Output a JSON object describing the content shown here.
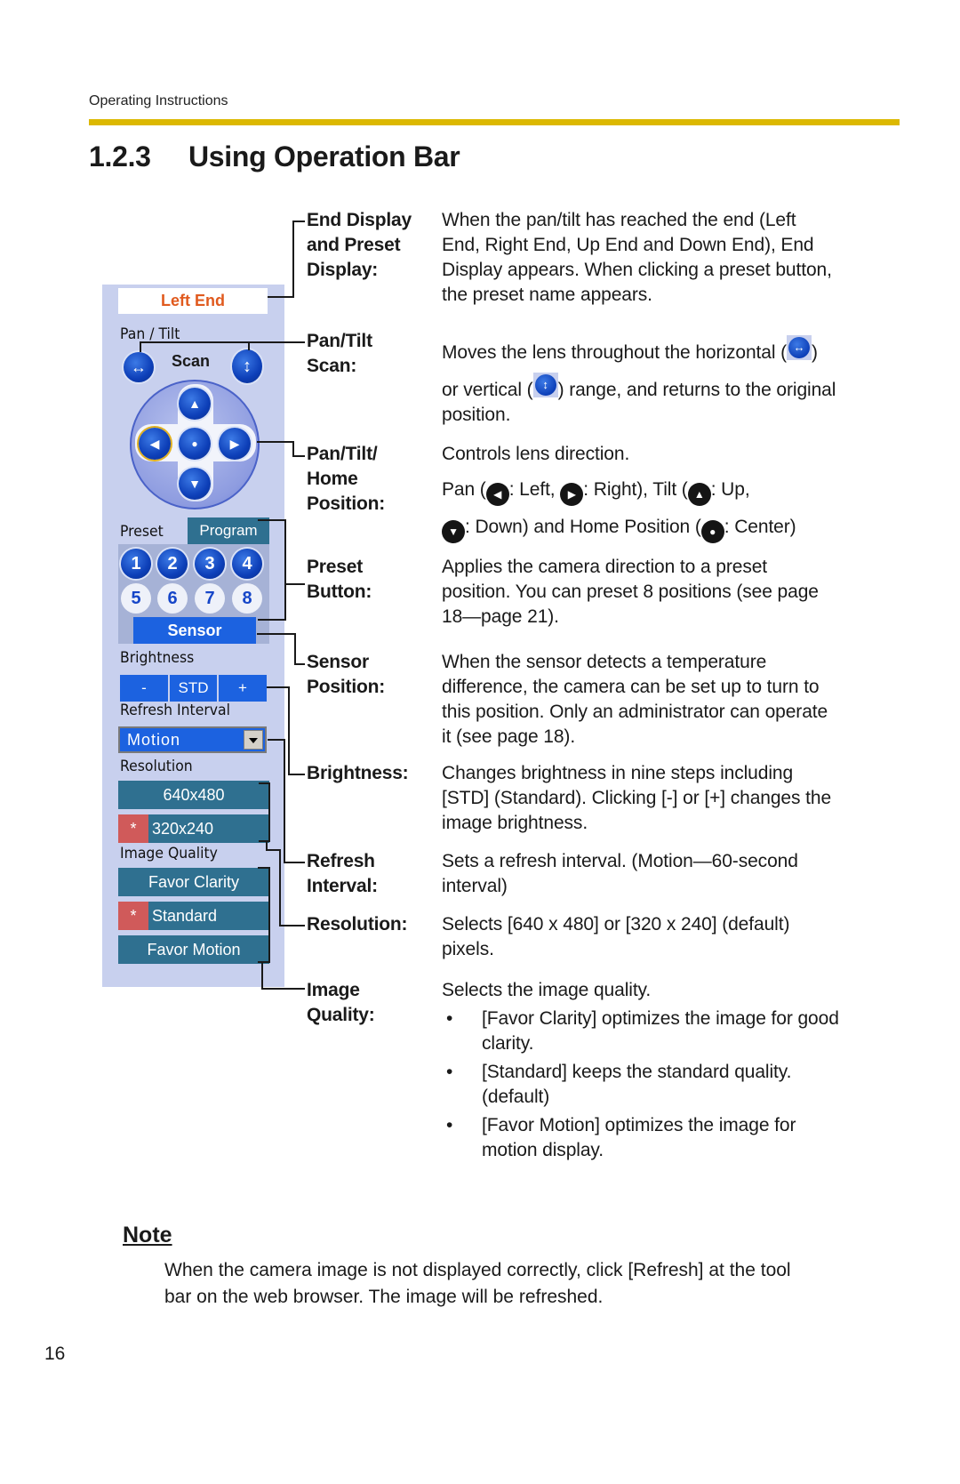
{
  "header": {
    "running_title": "Operating Instructions"
  },
  "section": {
    "number": "1.2.3",
    "title": "Using Operation Bar"
  },
  "operation_bar": {
    "end_display": "Left End",
    "pan_tilt_label": "Pan / Tilt",
    "scan_label": "Scan",
    "scan_h_icon": "horizontal-arrows-icon",
    "scan_v_icon": "vertical-arrows-icon",
    "direction_icons": {
      "up": "▲",
      "down": "▼",
      "left": "◀",
      "right": "▶",
      "home": "●"
    },
    "preset_label": "Preset",
    "program_label": "Program",
    "preset_buttons": [
      "1",
      "2",
      "3",
      "4",
      "5",
      "6",
      "7",
      "8"
    ],
    "sensor_label": "Sensor",
    "brightness_label": "Brightness",
    "brightness_buttons": {
      "minus": "-",
      "std": "STD",
      "plus": "+"
    },
    "refresh_label": "Refresh Interval",
    "refresh_value": "Motion",
    "resolution_label": "Resolution",
    "resolution_options": [
      {
        "label": "640x480",
        "selected": false
      },
      {
        "label": "320x240",
        "selected": true
      }
    ],
    "quality_label": "Image Quality",
    "quality_options": [
      {
        "label": "Favor Clarity",
        "selected": false
      },
      {
        "label": "Standard",
        "selected": true
      },
      {
        "label": "Favor Motion",
        "selected": false
      }
    ],
    "selected_marker": "*",
    "colors": {
      "panel_bg": "#c8d0ee",
      "button_blue": "#1c62e0",
      "option_teal": "#2f7090",
      "selected_red": "#d05a5a",
      "end_text": "#e05a1e"
    }
  },
  "descriptions": {
    "end_display": {
      "term": [
        "End Display",
        "and Preset",
        "Display:"
      ],
      "text": [
        "When the pan/tilt has reached the end (Left",
        "End, Right End, Up End and Down End), End",
        "Display appears. When clicking a preset button,",
        "the preset name appears."
      ]
    },
    "scan": {
      "term": [
        "Pan/Tilt",
        "Scan:"
      ],
      "line1_pre": "Moves the lens throughout the horizontal (",
      "line1_post": ")",
      "line2_pre": "or vertical (",
      "line2_post": ") range, and returns to the original",
      "line3": "position."
    },
    "home": {
      "term": [
        "Pan/Tilt/",
        "Home",
        "Position:"
      ],
      "line1": "Controls lens direction.",
      "pan_pre": "Pan (",
      "left": ": Left, ",
      "right": ": Right), Tilt (",
      "up": ": Up,",
      "down": ": Down) and Home Position (",
      "center": ": Center)"
    },
    "preset": {
      "term": [
        "Preset",
        "Button:"
      ],
      "text": [
        "Applies the camera direction to a preset",
        "position. You can preset 8 positions (see page",
        "18—page 21)."
      ]
    },
    "sensor": {
      "term": [
        "Sensor",
        "Position:"
      ],
      "text": [
        "When the sensor detects a temperature",
        "difference, the camera can be set up to turn to",
        "this position. Only an administrator can operate",
        "it (see page 18)."
      ]
    },
    "brightness": {
      "term": [
        "Brightness:"
      ],
      "text": [
        "Changes brightness in nine steps including",
        "[STD] (Standard). Clicking [-] or [+] changes the",
        "image brightness."
      ]
    },
    "refresh": {
      "term": [
        "Refresh",
        "Interval:"
      ],
      "text": [
        "Sets a refresh interval. (Motion—60-second",
        "interval)"
      ]
    },
    "resolution": {
      "term": [
        "Resolution:"
      ],
      "text": [
        "Selects [640 x 480] or [320 x 240] (default)",
        "pixels."
      ]
    },
    "quality": {
      "term": [
        "Image",
        "Quality:"
      ],
      "intro": "Selects the image quality.",
      "bullets": [
        [
          "[Favor Clarity] optimizes the image for good",
          "clarity."
        ],
        [
          "[Standard] keeps the standard quality.",
          "(default)"
        ],
        [
          "[Favor Motion] optimizes the image for",
          "motion display."
        ]
      ]
    }
  },
  "note": {
    "title": "Note",
    "text": [
      "When the camera image is not displayed correctly, click [Refresh] at the tool",
      "bar on the web browser. The image will be refreshed."
    ]
  },
  "page_number": "16"
}
